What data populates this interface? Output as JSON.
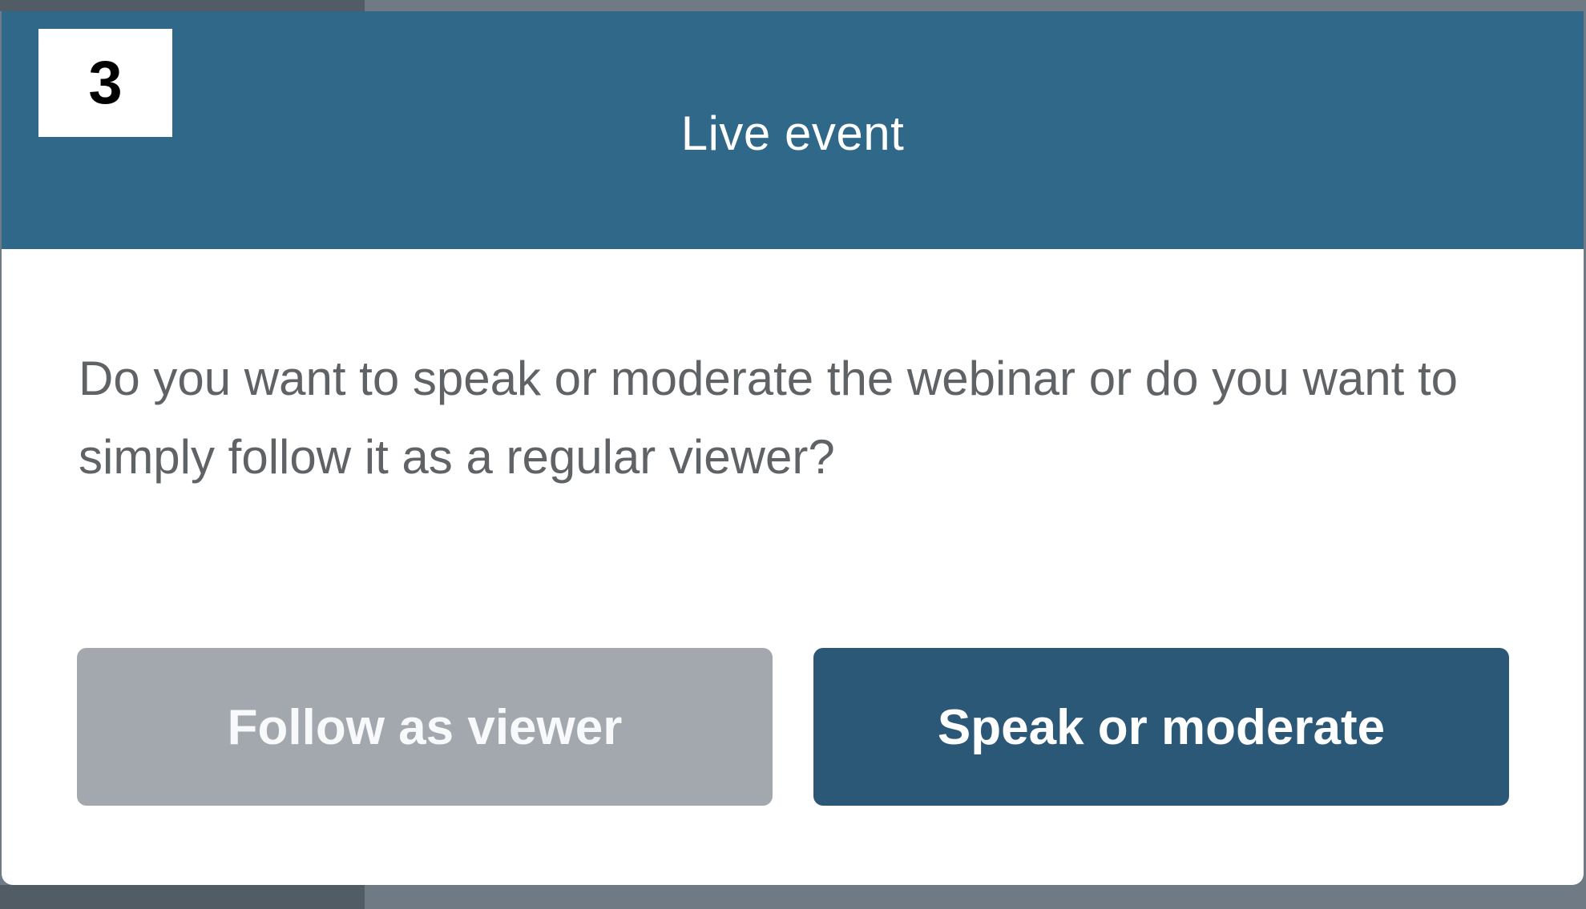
{
  "step_badge": "3",
  "dialog": {
    "title": "Live event",
    "message": "Do you want to speak or moderate the webinar or do you want to simply follow it as a regular viewer?",
    "buttons": {
      "follow_label": "Follow as viewer",
      "speak_label": "Speak or moderate"
    }
  },
  "colors": {
    "header": "#30688a",
    "primary_button": "#2c5878",
    "secondary_button": "#a2a8ad",
    "message_text": "#5f6366",
    "backdrop": "#6f7a84"
  }
}
